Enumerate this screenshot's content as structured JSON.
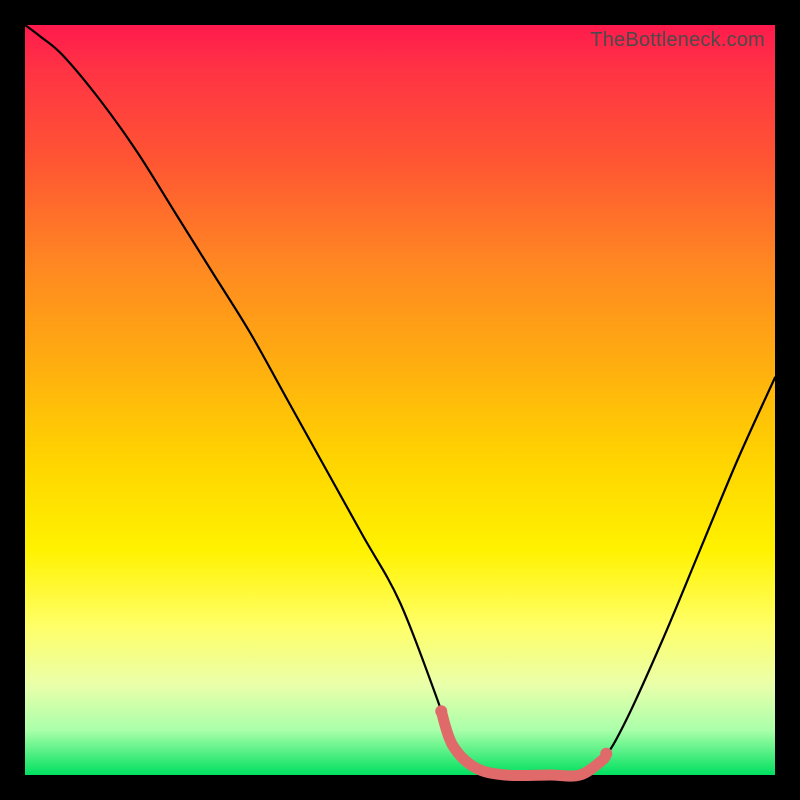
{
  "watermark": "TheBottleneck.com",
  "colors": {
    "frame": "#000000",
    "gradient_top": "#ff1a4d",
    "gradient_bottom": "#00e060",
    "curve": "#000000",
    "highlight": "#e06a6a"
  },
  "chart_data": {
    "type": "line",
    "title": "",
    "xlabel": "",
    "ylabel": "",
    "xlim": [
      0,
      1
    ],
    "ylim": [
      0,
      1
    ],
    "note": "Axes are unlabeled in the source image; x/y normalized to [0,1]. y represents the curve height from bottom (0) to top (1). Values estimated visually.",
    "series": [
      {
        "name": "curve",
        "x": [
          0.0,
          0.02,
          0.05,
          0.1,
          0.15,
          0.2,
          0.25,
          0.3,
          0.35,
          0.4,
          0.45,
          0.5,
          0.55,
          0.57,
          0.6,
          0.64,
          0.7,
          0.74,
          0.77,
          0.8,
          0.85,
          0.9,
          0.95,
          1.0
        ],
        "y": [
          1.0,
          0.985,
          0.96,
          0.9,
          0.83,
          0.75,
          0.67,
          0.59,
          0.5,
          0.41,
          0.32,
          0.23,
          0.1,
          0.04,
          0.01,
          0.0,
          0.0,
          0.0,
          0.02,
          0.07,
          0.18,
          0.3,
          0.42,
          0.53
        ]
      }
    ],
    "highlight_region": {
      "name": "bottom-flat",
      "x_start": 0.555,
      "x_end": 0.775,
      "description": "Thicker pink/red segment near the minimum of the curve"
    }
  }
}
